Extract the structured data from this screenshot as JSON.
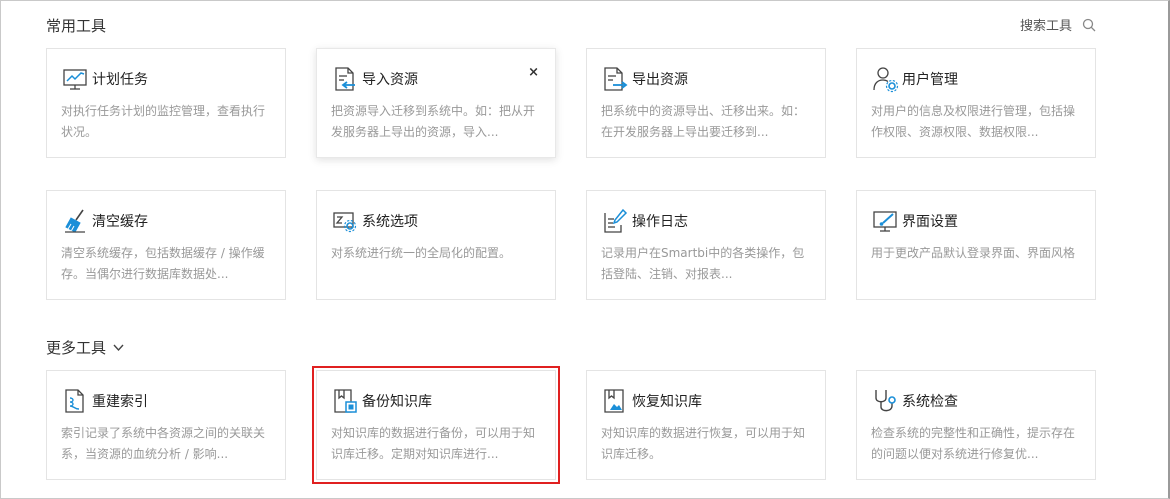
{
  "sections": {
    "common": "常用工具",
    "more": "更多工具"
  },
  "search": {
    "label": "搜索工具"
  },
  "close_glyph": "×",
  "cards": [
    {
      "title": "计划任务",
      "desc": "对执行任务计划的监控管理，查看执行状况。"
    },
    {
      "title": "导入资源",
      "desc": "把资源导入迁移到系统中。如：把从开发服务器上导出的资源，导入..."
    },
    {
      "title": "导出资源",
      "desc": "把系统中的资源导出、迁移出来。如：在开发服务器上导出要迁移到..."
    },
    {
      "title": "用户管理",
      "desc": "对用户的信息及权限进行管理，包括操作权限、资源权限、数据权限..."
    },
    {
      "title": "清空缓存",
      "desc": "清空系统缓存，包括数据缓存 / 操作缓存。当偶尔进行数据库数据处..."
    },
    {
      "title": "系统选项",
      "desc": "对系统进行统一的全局化的配置。"
    },
    {
      "title": "操作日志",
      "desc": "记录用户在Smartbi中的各类操作，包括登陆、注销、对报表..."
    },
    {
      "title": "界面设置",
      "desc": "用于更改产品默认登录界面、界面风格"
    },
    {
      "title": "重建索引",
      "desc": "索引记录了系统中各资源之间的关联关系，当资源的血统分析 / 影响..."
    },
    {
      "title": "备份知识库",
      "desc": "对知识库的数据进行备份，可以用于知识库迁移。定期对知识库进行..."
    },
    {
      "title": "恢复知识库",
      "desc": "对知识库的数据进行恢复，可以用于知识库迁移。"
    },
    {
      "title": "系统检查",
      "desc": "检查系统的完整性和正确性，提示存在的问题以便对系统进行修复优..."
    }
  ],
  "colors": {
    "accent": "#1b8fd8",
    "icon_dark": "#444444",
    "highlight": "#e02020"
  }
}
